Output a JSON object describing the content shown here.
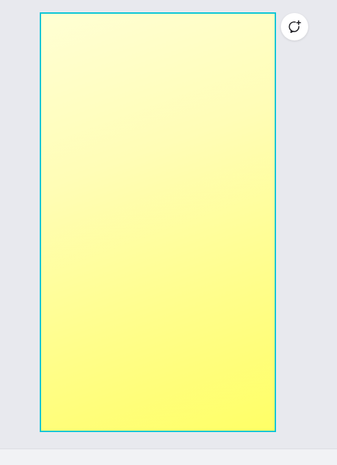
{
  "editor": {
    "workspace_bg": "#e8e9ee",
    "page": {
      "selected": true,
      "selection_color": "#00c4d6",
      "fill_gradient": [
        "#ffffd4",
        "#ffff66"
      ]
    },
    "comment_button": {
      "icon": "comment-add-icon"
    }
  }
}
